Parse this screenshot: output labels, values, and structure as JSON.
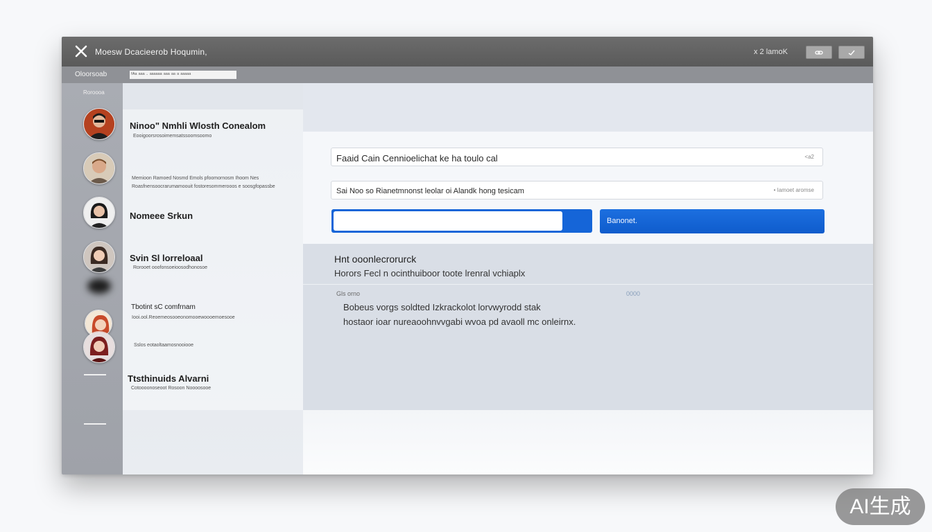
{
  "window": {
    "title": "Moesw Dcacieerob Hoqumin,",
    "status": "x 2 lamoK",
    "toolbar_label": "Oloorsoab",
    "toolbar_path": "ᶠᴬᵃ ᵃᵃᵃ · ᵃᵃᵃᵃᵃᵃ ᵃᵃᵃ ᵃᵃ ᵃ ᵃᵃᵃᵃᵃ"
  },
  "sidebar": {
    "rail_label": "Roroooa",
    "contacts": [
      {
        "name": "Ninoo\" Nmhli Wlosth Conealom",
        "subtitle": "Eooigoorsrosoimemsatssoomsoomo"
      },
      {
        "name": "",
        "subtitle": "Memioon Ramoed Nosmd Emols pfoomornosm Ihoom Nes\nRoasfnensoocrarumamoouit fostoresommerooos e soosgfopassbe"
      },
      {
        "name": "Nomeee Srkun",
        "subtitle": ""
      },
      {
        "name": "Svin Sl lorreloaal",
        "subtitle": "Rorooet ooofonsoeioosodhonosoe"
      },
      {
        "name": "Tbotint sC comfrnam",
        "subtitle": "Iooi.ool.Reoemeosooeonomooewoooemoesooe"
      },
      {
        "name": "",
        "subtitle": "Sslos eotaoltaamosnooiooe"
      },
      {
        "name": "Ttsthinuids Alvarni",
        "subtitle": "Cotoooonoseoot Rosoon Noooosooe"
      }
    ]
  },
  "form": {
    "field1_value": "Faaid Cain Cennioelichat ke ha toulo cal",
    "field1_hint": "<a2",
    "field2_value": "Sai Noo so Rianetmnonst leolar oi Alandk hong tesicam",
    "field2_hint": "• Iamoet aromse",
    "compose_value": "",
    "send_label": "Banonet."
  },
  "detail": {
    "heading": "Hnt ooonlecrorurck",
    "subheading": "Horors Fecl n ocinthuiboor toote lrenral vchiaplx",
    "meta_left": "Gls orno",
    "meta_right": "0000",
    "body_line1": "Bobeus vorgs soldted Izkrackolot lorvwyrodd stak",
    "body_line2": "hostaor ioar nureaoohnvvgabi wvoa pd avaoll mc onleirnx."
  },
  "badge": {
    "text": "AI生成"
  },
  "colors": {
    "titlebar": "#5f5f5f",
    "accent": "#1565d8",
    "rail": "#a5a8ae"
  }
}
